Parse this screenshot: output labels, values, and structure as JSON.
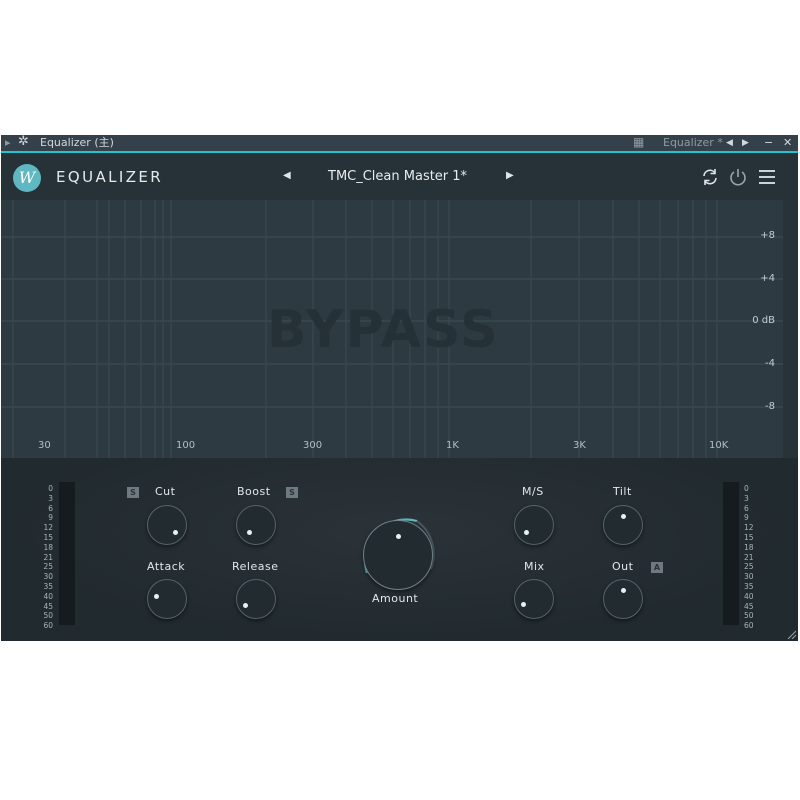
{
  "host": {
    "title": "Equalizer (主)",
    "window_name": "Equalizer *",
    "minimize": "−",
    "close": "✕"
  },
  "plugin": {
    "logo_letter": "W",
    "brand": "EQUALIZER",
    "preset_name": "TMC_Clean Master 1*"
  },
  "graph": {
    "overlay_text": "BYPASS",
    "db_labels": [
      "+8",
      "+4",
      "0 dB",
      "-4",
      "-8"
    ],
    "freq_labels": [
      "30",
      "100",
      "300",
      "1K",
      "3K",
      "10K"
    ]
  },
  "meters": {
    "scale": [
      "0",
      "3",
      "6",
      "9",
      "12",
      "15",
      "18",
      "21",
      "25",
      "30",
      "35",
      "40",
      "45",
      "50",
      "60"
    ]
  },
  "controls": {
    "cut": {
      "label": "Cut",
      "badge": "S"
    },
    "boost": {
      "label": "Boost",
      "badge": "S"
    },
    "attack": {
      "label": "Attack"
    },
    "release": {
      "label": "Release"
    },
    "amount": {
      "label": "Amount"
    },
    "ms": {
      "label": "M/S"
    },
    "tilt": {
      "label": "Tilt"
    },
    "mix": {
      "label": "Mix"
    },
    "out": {
      "label": "Out",
      "badge": "A"
    }
  },
  "colors": {
    "accent": "#1ec7cf",
    "logo": "#5fb7c1",
    "background": "#2e3a40"
  },
  "icons": [
    "gear-icon",
    "piano-icon",
    "arrow-left-icon",
    "arrow-right-icon",
    "refresh-icon",
    "power-icon",
    "menu-icon",
    "resize-icon"
  ]
}
